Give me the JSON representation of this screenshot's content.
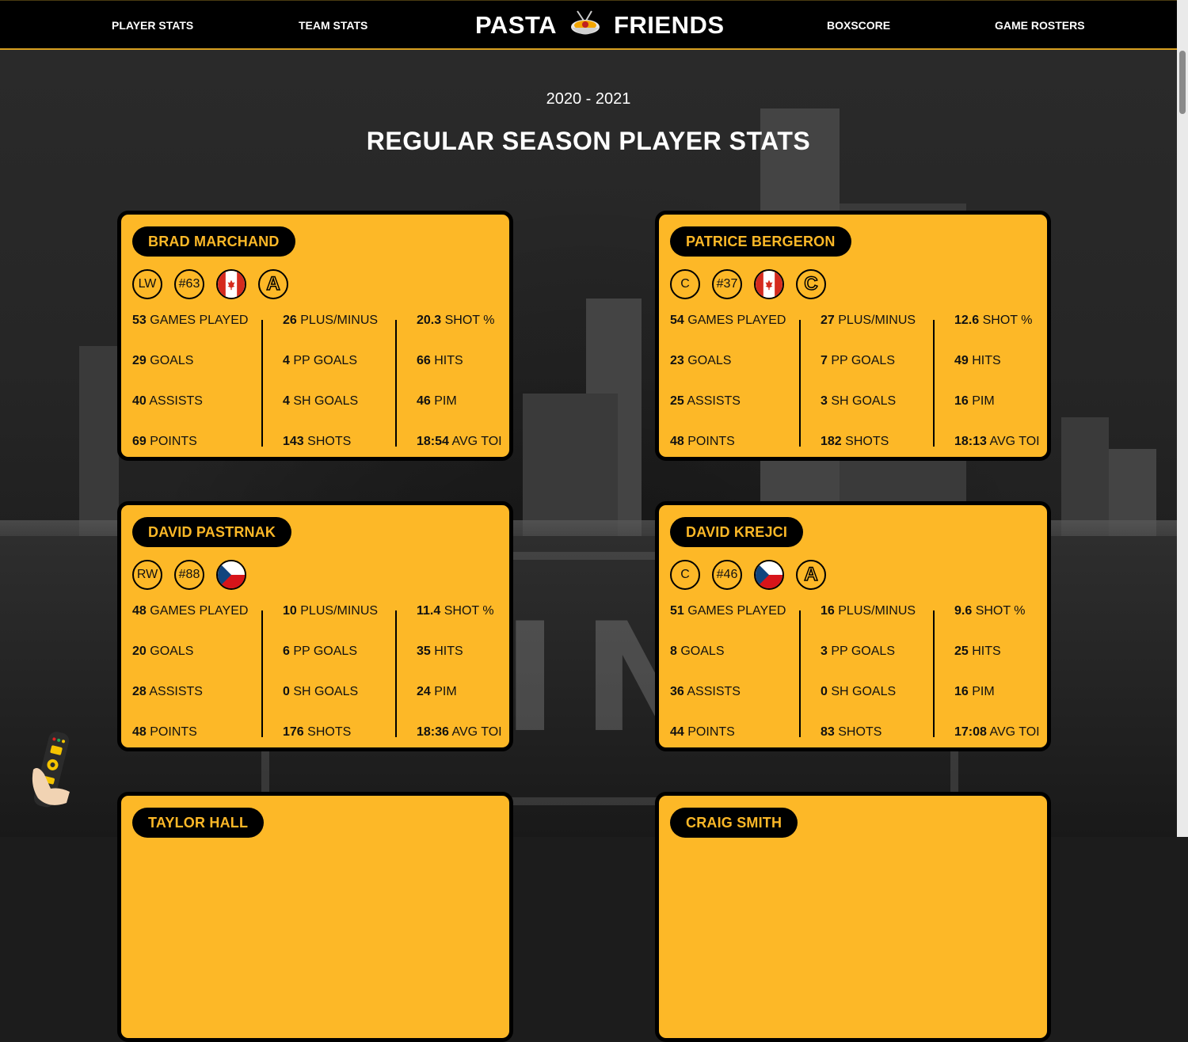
{
  "nav": {
    "player_stats": "PLAYER STATS",
    "team_stats": "TEAM STATS",
    "brand_left": "PASTA",
    "brand_right": "FRIENDS",
    "boxscore": "BOXSCORE",
    "game_rosters": "GAME ROSTERS"
  },
  "season": "2020 - 2021",
  "page_title": "REGULAR SEASON PLAYER STATS",
  "colors": {
    "gold": "#fdb827",
    "black": "#000000"
  },
  "players": [
    {
      "name": "BRAD MARCHAND",
      "position": "LW",
      "number": "#63",
      "flag": "canada",
      "letter": "A",
      "stats": [
        [
          [
            "53",
            "GAMES PLAYED"
          ],
          [
            "29",
            "GOALS"
          ],
          [
            "40",
            "ASSISTS"
          ],
          [
            "69",
            "POINTS"
          ]
        ],
        [
          [
            "26",
            "PLUS/MINUS"
          ],
          [
            "4",
            "PP GOALS"
          ],
          [
            "4",
            "SH GOALS"
          ],
          [
            "143",
            "SHOTS"
          ]
        ],
        [
          [
            "20.3",
            "SHOT %"
          ],
          [
            "66",
            "HITS"
          ],
          [
            "46",
            "PIM"
          ],
          [
            "18:54",
            "AVG TOI"
          ]
        ]
      ]
    },
    {
      "name": "PATRICE BERGERON",
      "position": "C",
      "number": "#37",
      "flag": "canada",
      "letter": "C",
      "stats": [
        [
          [
            "54",
            "GAMES PLAYED"
          ],
          [
            "23",
            "GOALS"
          ],
          [
            "25",
            "ASSISTS"
          ],
          [
            "48",
            "POINTS"
          ]
        ],
        [
          [
            "27",
            "PLUS/MINUS"
          ],
          [
            "7",
            "PP GOALS"
          ],
          [
            "3",
            "SH GOALS"
          ],
          [
            "182",
            "SHOTS"
          ]
        ],
        [
          [
            "12.6",
            "SHOT %"
          ],
          [
            "49",
            "HITS"
          ],
          [
            "16",
            "PIM"
          ],
          [
            "18:13",
            "AVG TOI"
          ]
        ]
      ]
    },
    {
      "name": "DAVID PASTRNAK",
      "position": "RW",
      "number": "#88",
      "flag": "czech",
      "letter": "",
      "stats": [
        [
          [
            "48",
            "GAMES PLAYED"
          ],
          [
            "20",
            "GOALS"
          ],
          [
            "28",
            "ASSISTS"
          ],
          [
            "48",
            "POINTS"
          ]
        ],
        [
          [
            "10",
            "PLUS/MINUS"
          ],
          [
            "6",
            "PP GOALS"
          ],
          [
            "0",
            "SH GOALS"
          ],
          [
            "176",
            "SHOTS"
          ]
        ],
        [
          [
            "11.4",
            "SHOT %"
          ],
          [
            "35",
            "HITS"
          ],
          [
            "24",
            "PIM"
          ],
          [
            "18:36",
            "AVG TOI"
          ]
        ]
      ]
    },
    {
      "name": "DAVID KREJCI",
      "position": "C",
      "number": "#46",
      "flag": "czech",
      "letter": "A",
      "stats": [
        [
          [
            "51",
            "GAMES PLAYED"
          ],
          [
            "8",
            "GOALS"
          ],
          [
            "36",
            "ASSISTS"
          ],
          [
            "44",
            "POINTS"
          ]
        ],
        [
          [
            "16",
            "PLUS/MINUS"
          ],
          [
            "3",
            "PP GOALS"
          ],
          [
            "0",
            "SH GOALS"
          ],
          [
            "83",
            "SHOTS"
          ]
        ],
        [
          [
            "9.6",
            "SHOT %"
          ],
          [
            "25",
            "HITS"
          ],
          [
            "16",
            "PIM"
          ],
          [
            "17:08",
            "AVG TOI"
          ]
        ]
      ]
    },
    {
      "name": "TAYLOR HALL"
    },
    {
      "name": "CRAIG SMITH"
    }
  ]
}
